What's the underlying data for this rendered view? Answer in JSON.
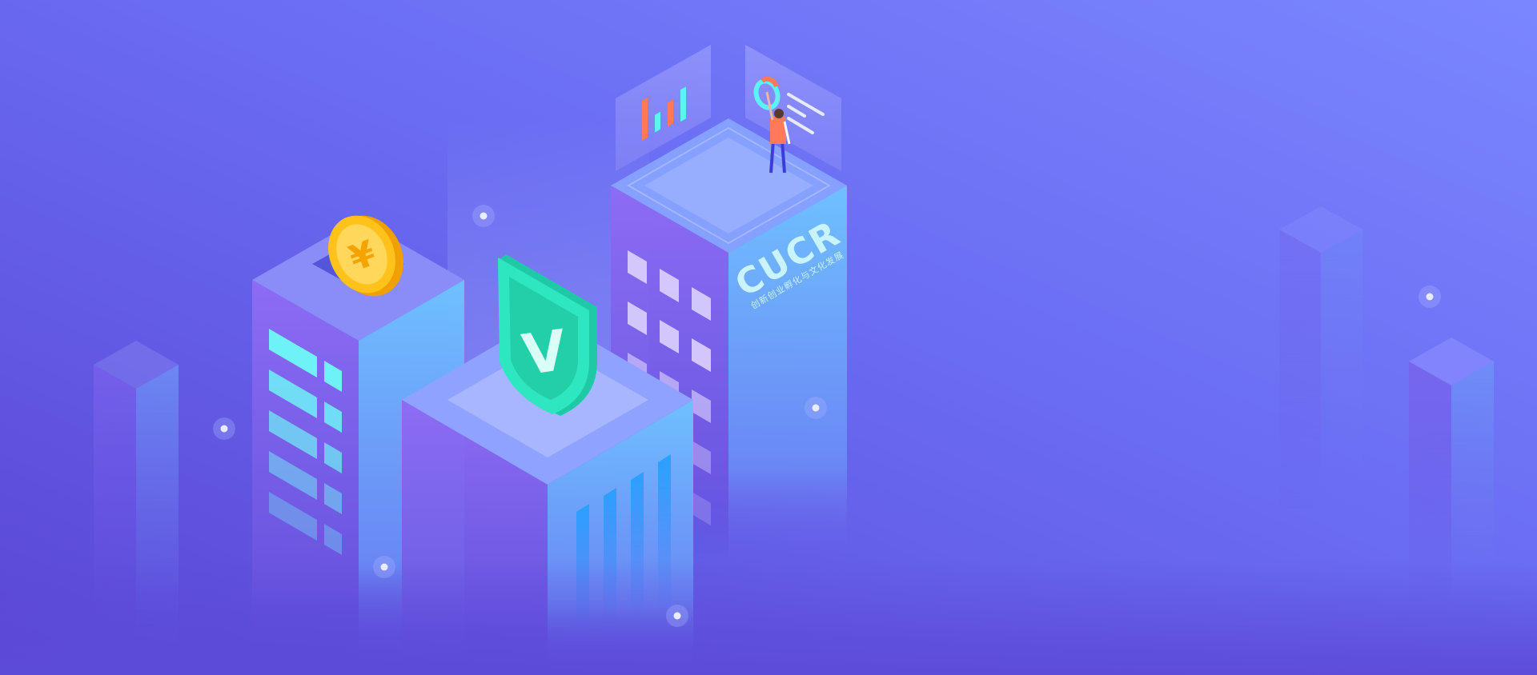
{
  "hero": {
    "brand_logo_text": "CUCR",
    "brand_logo_subtitle": "创新创业孵化与文化发展",
    "coin_symbol": "¥",
    "shield_symbol": "V"
  },
  "colors": {
    "background_start": "#5a46d4",
    "background_end": "#7385ff",
    "tower_left_face": "#8766f0",
    "tower_right_face": "#6fb8ff",
    "tower_top": "#8aa4ff",
    "shield_green": "#2ee6c0",
    "coin_gold": "#ffc21a",
    "panel_bar_orange": "#ff7a59",
    "panel_bar_cyan": "#5ef2f7"
  },
  "icons": [
    "yuan-coin-icon",
    "shield-check-icon",
    "bar-chart-icon",
    "donut-chart-icon",
    "text-lines-icon"
  ]
}
